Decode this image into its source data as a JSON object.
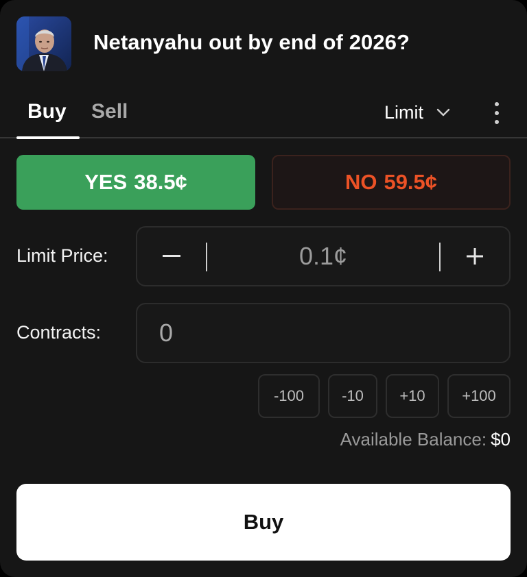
{
  "market": {
    "title": "Netanyahu out by end of 2026?",
    "thumbnail": "portrait-photo"
  },
  "tabs": {
    "buy": "Buy",
    "sell": "Sell",
    "active": "Buy"
  },
  "order_type": {
    "selected": "Limit",
    "icon": "chevron-down-icon"
  },
  "menu_icon": "more-vertical-icon",
  "outcomes": {
    "yes": {
      "label": "YES",
      "price": "38.5¢"
    },
    "no": {
      "label": "NO",
      "price": "59.5¢"
    }
  },
  "limit_price": {
    "label": "Limit Price:",
    "value": "0.1¢",
    "decrement_icon": "minus-icon",
    "increment_icon": "plus-icon"
  },
  "contracts": {
    "label": "Contracts:",
    "value": "0"
  },
  "quick_adjust": [
    "-100",
    "-10",
    "+10",
    "+100"
  ],
  "balance": {
    "label": "Available Balance:",
    "value": "$0"
  },
  "submit": {
    "label": "Buy"
  },
  "colors": {
    "background": "#161616",
    "yes": "#3aa05a",
    "no": "#ec5226",
    "muted": "#9a9a9a"
  }
}
